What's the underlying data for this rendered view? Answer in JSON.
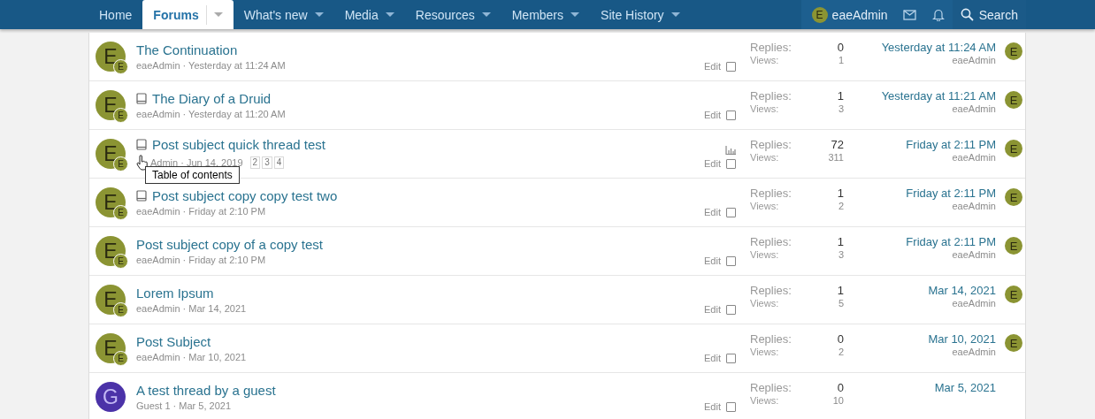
{
  "nav": {
    "items": [
      {
        "label": "Home",
        "selected": false,
        "has_dropdown": false
      },
      {
        "label": "Forums",
        "selected": true,
        "has_dropdown": true
      },
      {
        "label": "What's new",
        "selected": false,
        "has_dropdown": true
      },
      {
        "label": "Media",
        "selected": false,
        "has_dropdown": true
      },
      {
        "label": "Resources",
        "selected": false,
        "has_dropdown": true
      },
      {
        "label": "Members",
        "selected": false,
        "has_dropdown": true
      },
      {
        "label": "Site History",
        "selected": false,
        "has_dropdown": true
      }
    ],
    "user": {
      "initial": "E",
      "name": "eaeAdmin",
      "color": "#8b9433"
    },
    "search": "Search"
  },
  "threads": [
    {
      "initial": "E",
      "color": "#8b9433",
      "badge": "E",
      "prefix_icon": false,
      "title": "The Continuation",
      "meta": "eaeAdmin · Yesterday at 11:24 AM",
      "poll": false,
      "edit": "Edit",
      "checked": false,
      "replies_label": "Replies:",
      "replies": "0",
      "views_label": "Views:",
      "views": "1",
      "last_date": "Yesterday at 11:24 AM",
      "last_user": "eaeAdmin",
      "last_initial": "E"
    },
    {
      "initial": "E",
      "color": "#8b9433",
      "badge": "E",
      "prefix_icon": true,
      "title": "The Diary of a Druid",
      "meta": "eaeAdmin · Yesterday at 11:20 AM",
      "poll": false,
      "edit": "Edit",
      "checked": false,
      "replies_label": "Replies:",
      "replies": "1",
      "views_label": "Views:",
      "views": "3",
      "last_date": "Yesterday at 11:21 AM",
      "last_user": "eaeAdmin",
      "last_initial": "E"
    },
    {
      "initial": "E",
      "color": "#8b9433",
      "badge": "E",
      "prefix_icon": true,
      "title": "Post subject quick thread test",
      "meta": "Admin · Jun 14, 2019",
      "pages": [
        "2",
        "3",
        "4"
      ],
      "poll": true,
      "tooltip": "Table of contents",
      "edit": "Edit",
      "checked": false,
      "replies_label": "Replies:",
      "replies": "72",
      "views_label": "Views:",
      "views": "311",
      "last_date": "Friday at 2:11 PM",
      "last_user": "eaeAdmin",
      "last_initial": "E"
    },
    {
      "initial": "E",
      "color": "#8b9433",
      "badge": "E",
      "prefix_icon": true,
      "title": "Post subject copy copy test two",
      "meta": "eaeAdmin · Friday at 2:10 PM",
      "poll": false,
      "edit": "Edit",
      "checked": false,
      "replies_label": "Replies:",
      "replies": "1",
      "views_label": "Views:",
      "views": "2",
      "last_date": "Friday at 2:11 PM",
      "last_user": "eaeAdmin",
      "last_initial": "E"
    },
    {
      "initial": "E",
      "color": "#8b9433",
      "badge": "E",
      "prefix_icon": false,
      "title": "Post subject copy of a copy test",
      "meta": "eaeAdmin · Friday at 2:10 PM",
      "poll": false,
      "edit": "Edit",
      "checked": false,
      "replies_label": "Replies:",
      "replies": "1",
      "views_label": "Views:",
      "views": "3",
      "last_date": "Friday at 2:11 PM",
      "last_user": "eaeAdmin",
      "last_initial": "E"
    },
    {
      "initial": "E",
      "color": "#8b9433",
      "badge": "E",
      "prefix_icon": false,
      "title": "Lorem Ipsum",
      "meta": "eaeAdmin · Mar 14, 2021",
      "poll": false,
      "edit": "Edit",
      "checked": false,
      "replies_label": "Replies:",
      "replies": "1",
      "views_label": "Views:",
      "views": "5",
      "last_date": "Mar 14, 2021",
      "last_user": "eaeAdmin",
      "last_initial": "E"
    },
    {
      "initial": "E",
      "color": "#8b9433",
      "badge": "E",
      "prefix_icon": false,
      "title": "Post Subject",
      "meta": "eaeAdmin · Mar 10, 2021",
      "poll": false,
      "edit": "Edit",
      "checked": false,
      "replies_label": "Replies:",
      "replies": "0",
      "views_label": "Views:",
      "views": "2",
      "last_date": "Mar 10, 2021",
      "last_user": "eaeAdmin",
      "last_initial": "E"
    },
    {
      "initial": "G",
      "color": "#4b32a8",
      "prefix_icon": false,
      "title": "A test thread by a guest",
      "meta": "Guest 1 · Mar 5, 2021",
      "poll": false,
      "edit": "Edit",
      "checked": false,
      "replies_label": "Replies:",
      "replies": "0",
      "views_label": "Views:",
      "views": "10",
      "last_date": "Mar 5, 2021"
    }
  ]
}
